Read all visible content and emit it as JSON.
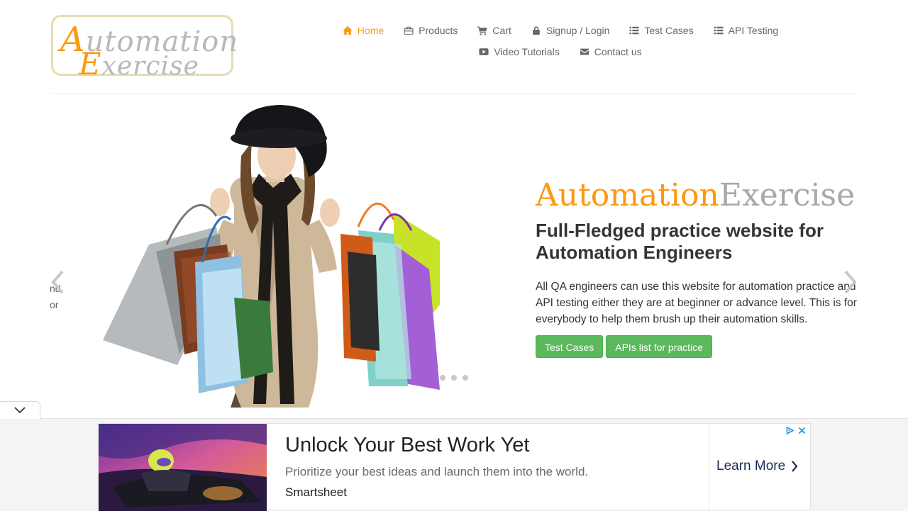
{
  "logo": {
    "line1_first": "A",
    "line1_rest": "utomation",
    "line2_first": "E",
    "line2_rest": "xercise"
  },
  "nav": {
    "items": [
      {
        "label": "Home",
        "icon": "home-icon"
      },
      {
        "label": "Products",
        "icon": "briefcase-icon"
      },
      {
        "label": "Cart",
        "icon": "cart-icon"
      },
      {
        "label": "Signup / Login",
        "icon": "lock-icon"
      },
      {
        "label": "Test Cases",
        "icon": "list-icon"
      },
      {
        "label": "API Testing",
        "icon": "list-icon"
      },
      {
        "label": "Video Tutorials",
        "icon": "youtube-play-icon"
      },
      {
        "label": "Contact us",
        "icon": "envelope-icon"
      }
    ],
    "active": "Home"
  },
  "slider": {
    "prev_slide_fragment": [
      "nd",
      "or"
    ],
    "brand_part1": "Automation",
    "brand_part2": "Exercise",
    "headline": "Full-Fledged practice website for Automation Engineers",
    "description": "All QA engineers can use this website for automation practice and API testing either they are at beginner or advance level. This is for everybody to help them brush up their automation skills.",
    "buttons": [
      "Test Cases",
      "APIs list for practice"
    ],
    "slide_count": 3
  },
  "ad": {
    "title": "Unlock Your Best Work Yet",
    "subtitle": "Prioritize your best ideas and launch them into the world.",
    "brand": "Smartsheet",
    "cta": "Learn More"
  },
  "colors": {
    "accent": "#fe980f",
    "button_green": "#5cb85c",
    "text_dark": "#363432",
    "text_muted": "#696763"
  }
}
